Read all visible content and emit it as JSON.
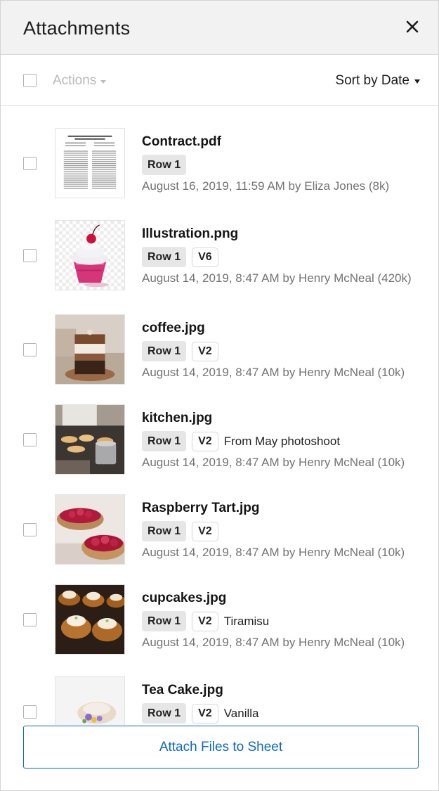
{
  "panel": {
    "title": "Attachments"
  },
  "toolbar": {
    "actions_label": "Actions",
    "sort_label": "Sort by Date"
  },
  "items": [
    {
      "name": "Contract.pdf",
      "row": "Row 1",
      "version": null,
      "note": "",
      "meta": "August 16, 2019, 11:59 AM by Eliza Jones (8k)",
      "thumb": "document-thumbnail"
    },
    {
      "name": "Illustration.png",
      "row": "Row 1",
      "version": "V6",
      "note": "",
      "meta": "August 14, 2019, 8:47 AM by Henry McNeal (420k)",
      "thumb": "cupcake-illustration-thumbnail"
    },
    {
      "name": "coffee.jpg",
      "row": "Row 1",
      "version": "V2",
      "note": "",
      "meta": "August 14, 2019, 8:47 AM by Henry McNeal (10k)",
      "thumb": "coffee-photo-thumbnail"
    },
    {
      "name": "kitchen.jpg",
      "row": "Row 1",
      "version": "V2",
      "note": "From May photoshoot",
      "meta": "August 14, 2019, 8:47 AM by Henry McNeal (10k)",
      "thumb": "kitchen-photo-thumbnail"
    },
    {
      "name": "Raspberry Tart.jpg",
      "row": "Row 1",
      "version": "V2",
      "note": "",
      "meta": "August 14, 2019, 8:47 AM by Henry McNeal (10k)",
      "thumb": "tart-photo-thumbnail"
    },
    {
      "name": "cupcakes.jpg",
      "row": "Row 1",
      "version": "V2",
      "note": "Tiramisu",
      "meta": "August 14, 2019, 8:47 AM by Henry McNeal (10k)",
      "thumb": "cupcakes-photo-thumbnail"
    },
    {
      "name": "Tea Cake.jpg",
      "row": "Row 1",
      "version": "V2",
      "note": "Vanilla",
      "meta": "",
      "thumb": "tea-cake-photo-thumbnail"
    }
  ],
  "footer": {
    "attach_label": "Attach Files to Sheet"
  },
  "colors": {
    "accent": "#0a68c7",
    "header_bg": "#f2f2f2",
    "tag_bg": "#e6e6e6",
    "meta_text": "#737373"
  }
}
